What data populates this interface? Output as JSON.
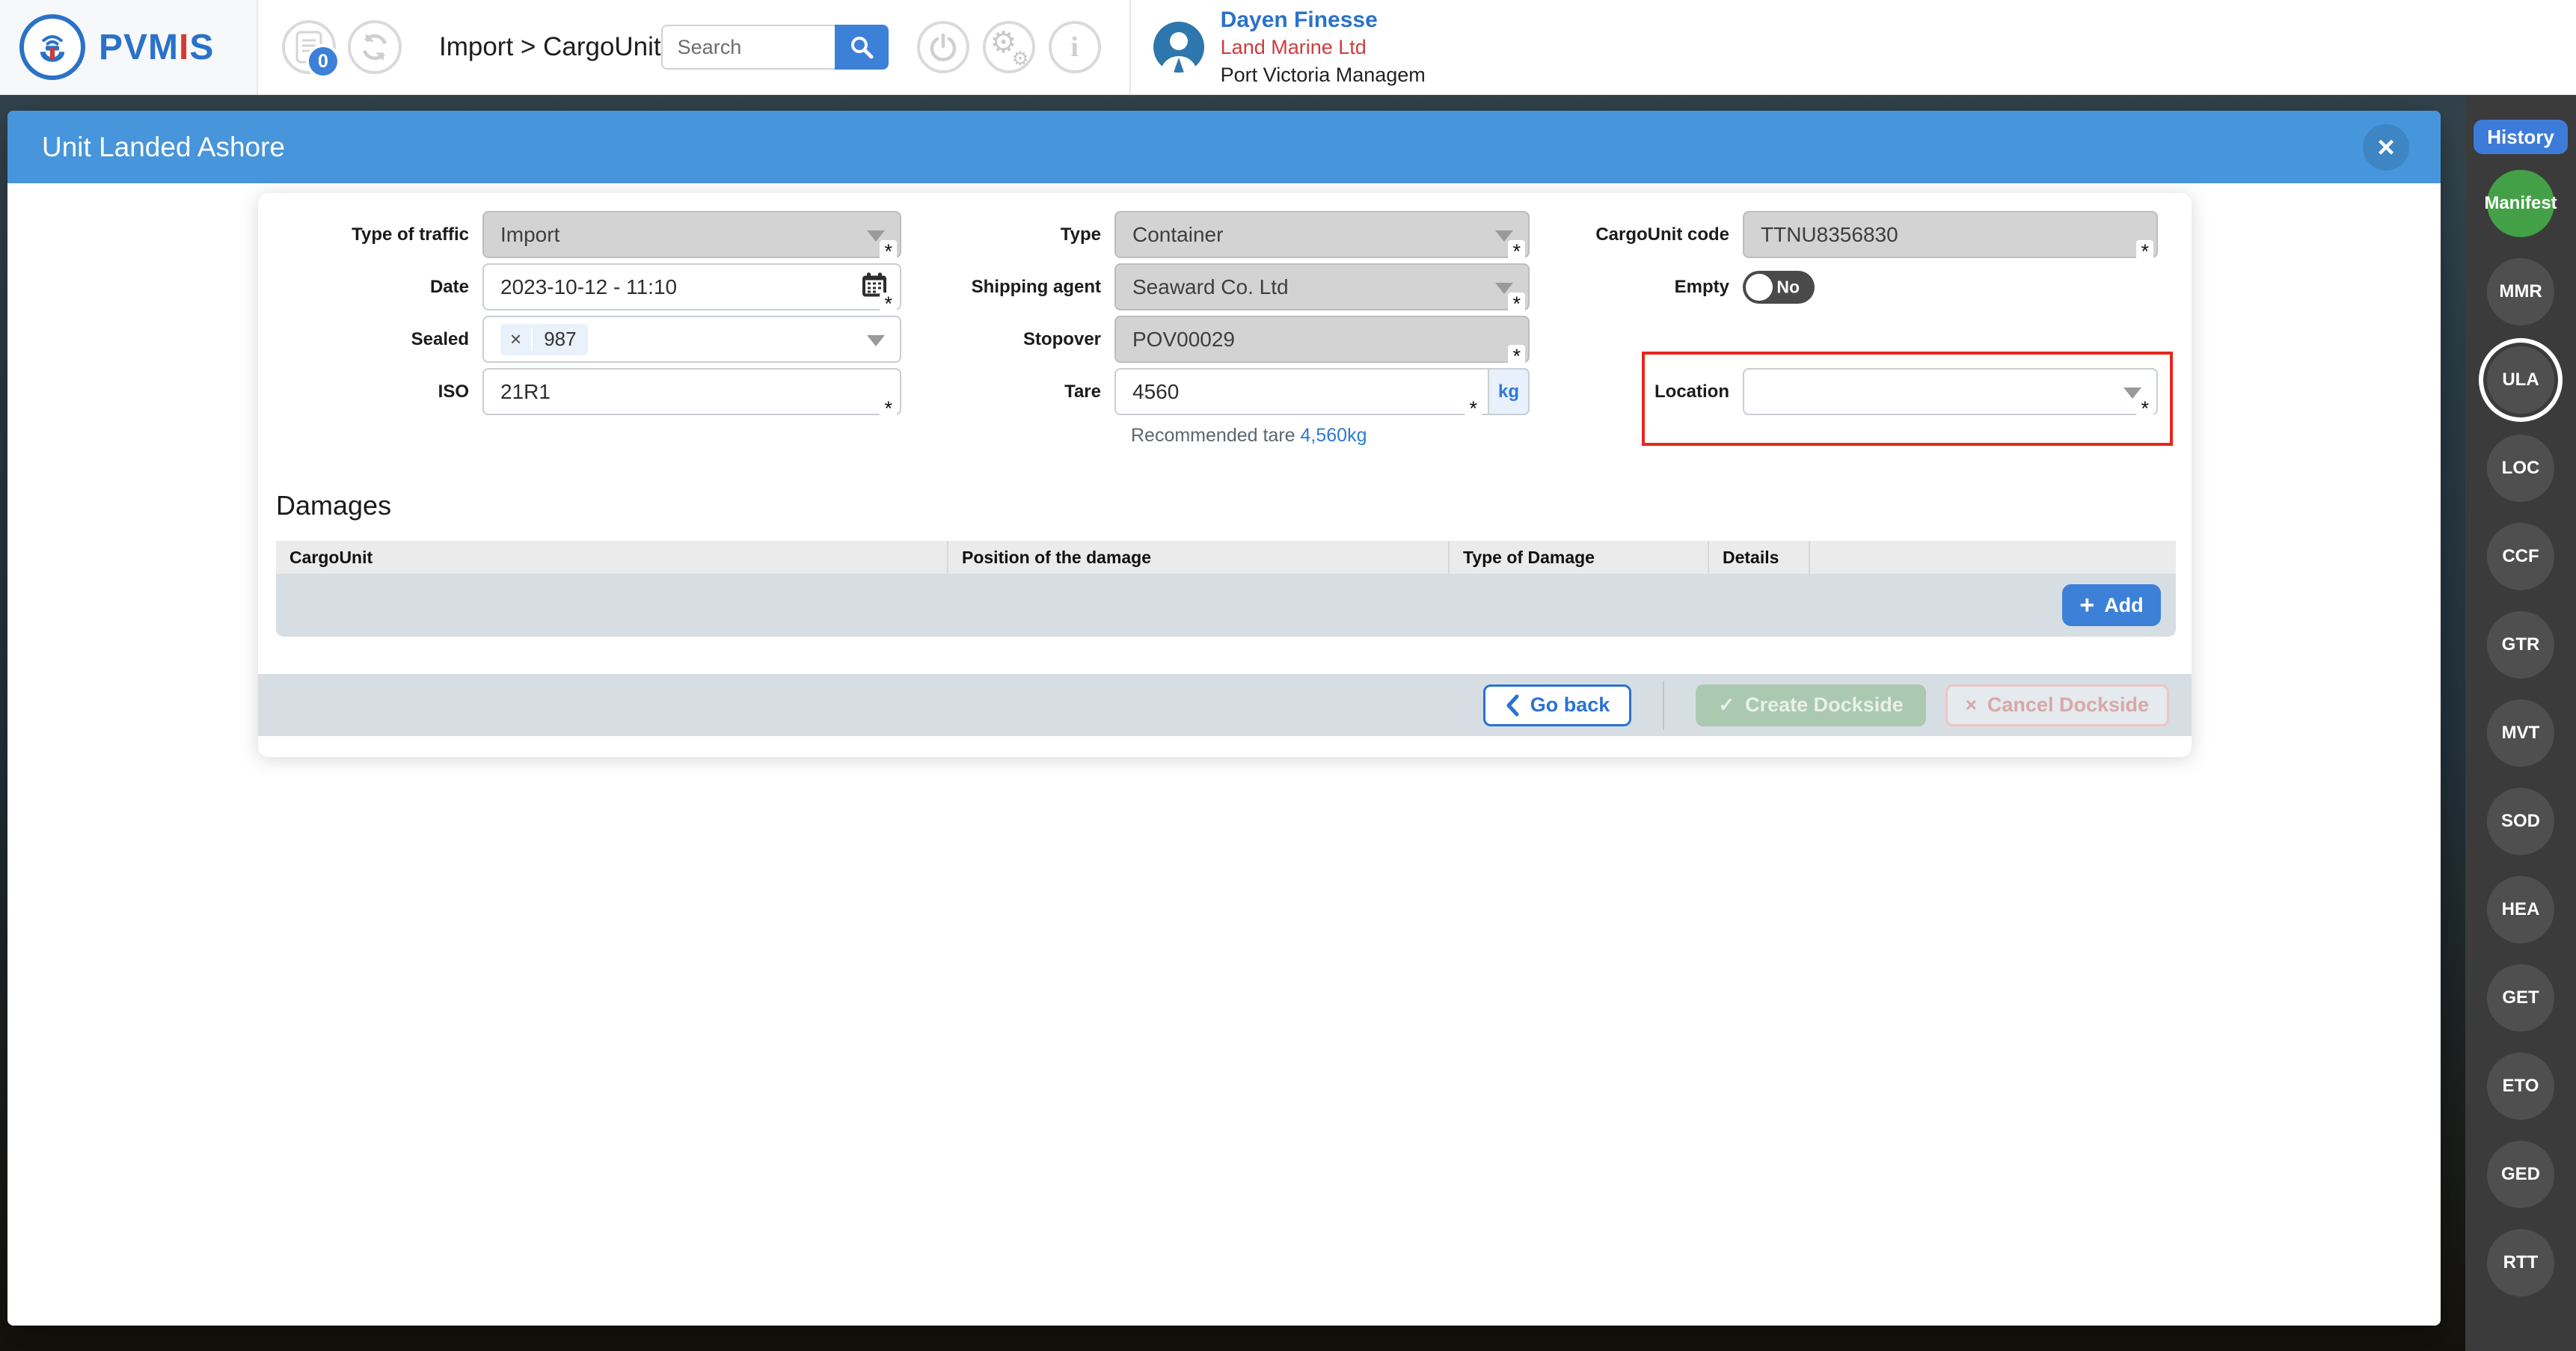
{
  "header": {
    "logo": {
      "part1": "PVM",
      "part_i": "I",
      "part2": "S"
    },
    "pending_badge": "0",
    "breadcrumb": "Import > CargoUnit",
    "search": {
      "placeholder": "Search"
    },
    "user": {
      "name": "Dayen Finesse",
      "company": "Land Marine Ltd",
      "organization": "Port Victoria Managem"
    }
  },
  "icons": {
    "close": "×",
    "chip_remove": "×",
    "check": "✓",
    "cancel_x": "×",
    "plus": "+",
    "gear": "⚙",
    "info": "i"
  },
  "modal": {
    "title": "Unit Landed Ashore",
    "required_marker": "*",
    "form": {
      "type_of_traffic": {
        "label": "Type of traffic",
        "value": "Import"
      },
      "date": {
        "label": "Date",
        "value": "2023-10-12 - 11:10"
      },
      "sealed": {
        "label": "Sealed",
        "chip_value": "987"
      },
      "iso": {
        "label": "ISO",
        "value": "21R1"
      },
      "type": {
        "label": "Type",
        "value": "Container"
      },
      "shipping_agent": {
        "label": "Shipping agent",
        "value": "Seaward Co. Ltd"
      },
      "stopover": {
        "label": "Stopover",
        "value": "POV00029"
      },
      "tare": {
        "label": "Tare",
        "value": "4560",
        "unit": "kg",
        "note_prefix": "Recommended tare",
        "note_value": "4,560kg"
      },
      "cargounit_code": {
        "label": "CargoUnit code",
        "value": "TTNU8356830"
      },
      "empty": {
        "label": "Empty",
        "value": "No"
      },
      "location": {
        "label": "Location",
        "value": ""
      }
    },
    "damages": {
      "title": "Damages",
      "columns": [
        "CargoUnit",
        "Position of the damage",
        "Type of Damage",
        "Details",
        ""
      ],
      "add_label": "Add"
    },
    "footer": {
      "go_back": "Go back",
      "create": "Create Dockside",
      "cancel": "Cancel Dockside"
    }
  },
  "sidebar": {
    "history_label": "History",
    "active": "ULA",
    "items": [
      {
        "label": "Manifest",
        "variant": "green"
      },
      {
        "label": "MMR",
        "variant": "default"
      },
      {
        "label": "ULA",
        "variant": "active"
      },
      {
        "label": "LOC",
        "variant": "default"
      },
      {
        "label": "CCF",
        "variant": "default"
      },
      {
        "label": "GTR",
        "variant": "default"
      },
      {
        "label": "MVT",
        "variant": "default"
      },
      {
        "label": "SOD",
        "variant": "default"
      },
      {
        "label": "HEA",
        "variant": "default"
      },
      {
        "label": "GET",
        "variant": "default"
      },
      {
        "label": "ETO",
        "variant": "default"
      },
      {
        "label": "GED",
        "variant": "default"
      },
      {
        "label": "RTT",
        "variant": "default"
      }
    ]
  },
  "colors": {
    "accent_blue": "#3c80d8",
    "modal_header_blue": "#4795da",
    "sidebar_bg": "#3b3b3b",
    "manifest_green": "#43a047",
    "annotation_red": "#e7271c",
    "disabled_field_grey": "#d3d3d3",
    "footer_bar_grey": "#d6dee3"
  }
}
